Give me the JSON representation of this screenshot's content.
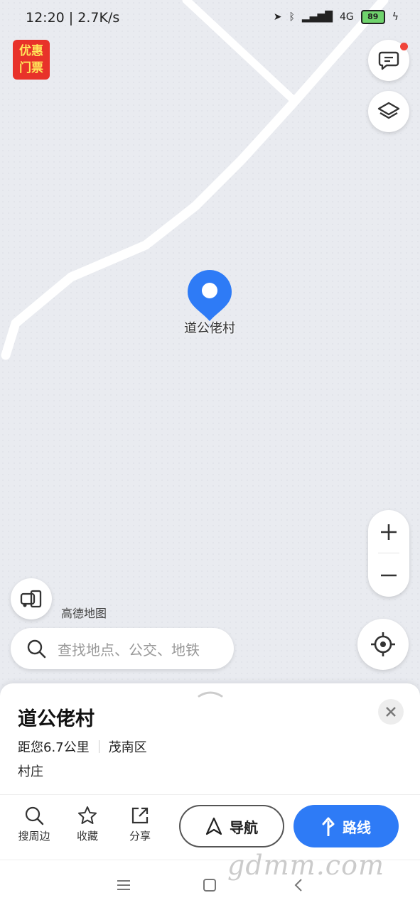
{
  "status_bar": {
    "time": "12:20 | 2.7K/s",
    "battery": "89",
    "network": "4G"
  },
  "promo": {
    "line1": "优惠",
    "line2": "门票"
  },
  "map": {
    "place_label": "道公佬村",
    "brand": "高德地图",
    "pin_color": "#2e7bf6"
  },
  "search": {
    "placeholder": "查找地点、公交、地铁"
  },
  "place_card": {
    "title": "道公佬村",
    "distance": "距您6.7公里",
    "district": "茂南区",
    "category": "村庄"
  },
  "actions": {
    "nearby": "搜周边",
    "favorite": "收藏",
    "share": "分享",
    "navigate": "导航",
    "route": "路线"
  },
  "watermark": "gdmm.com",
  "icons": [
    "message-icon",
    "layers-icon",
    "zoom-in-icon",
    "zoom-out-icon",
    "vehicle-icon",
    "locate-icon",
    "search-icon",
    "close-icon",
    "star-icon",
    "share-icon",
    "navigate-arrow-icon",
    "route-icon"
  ]
}
